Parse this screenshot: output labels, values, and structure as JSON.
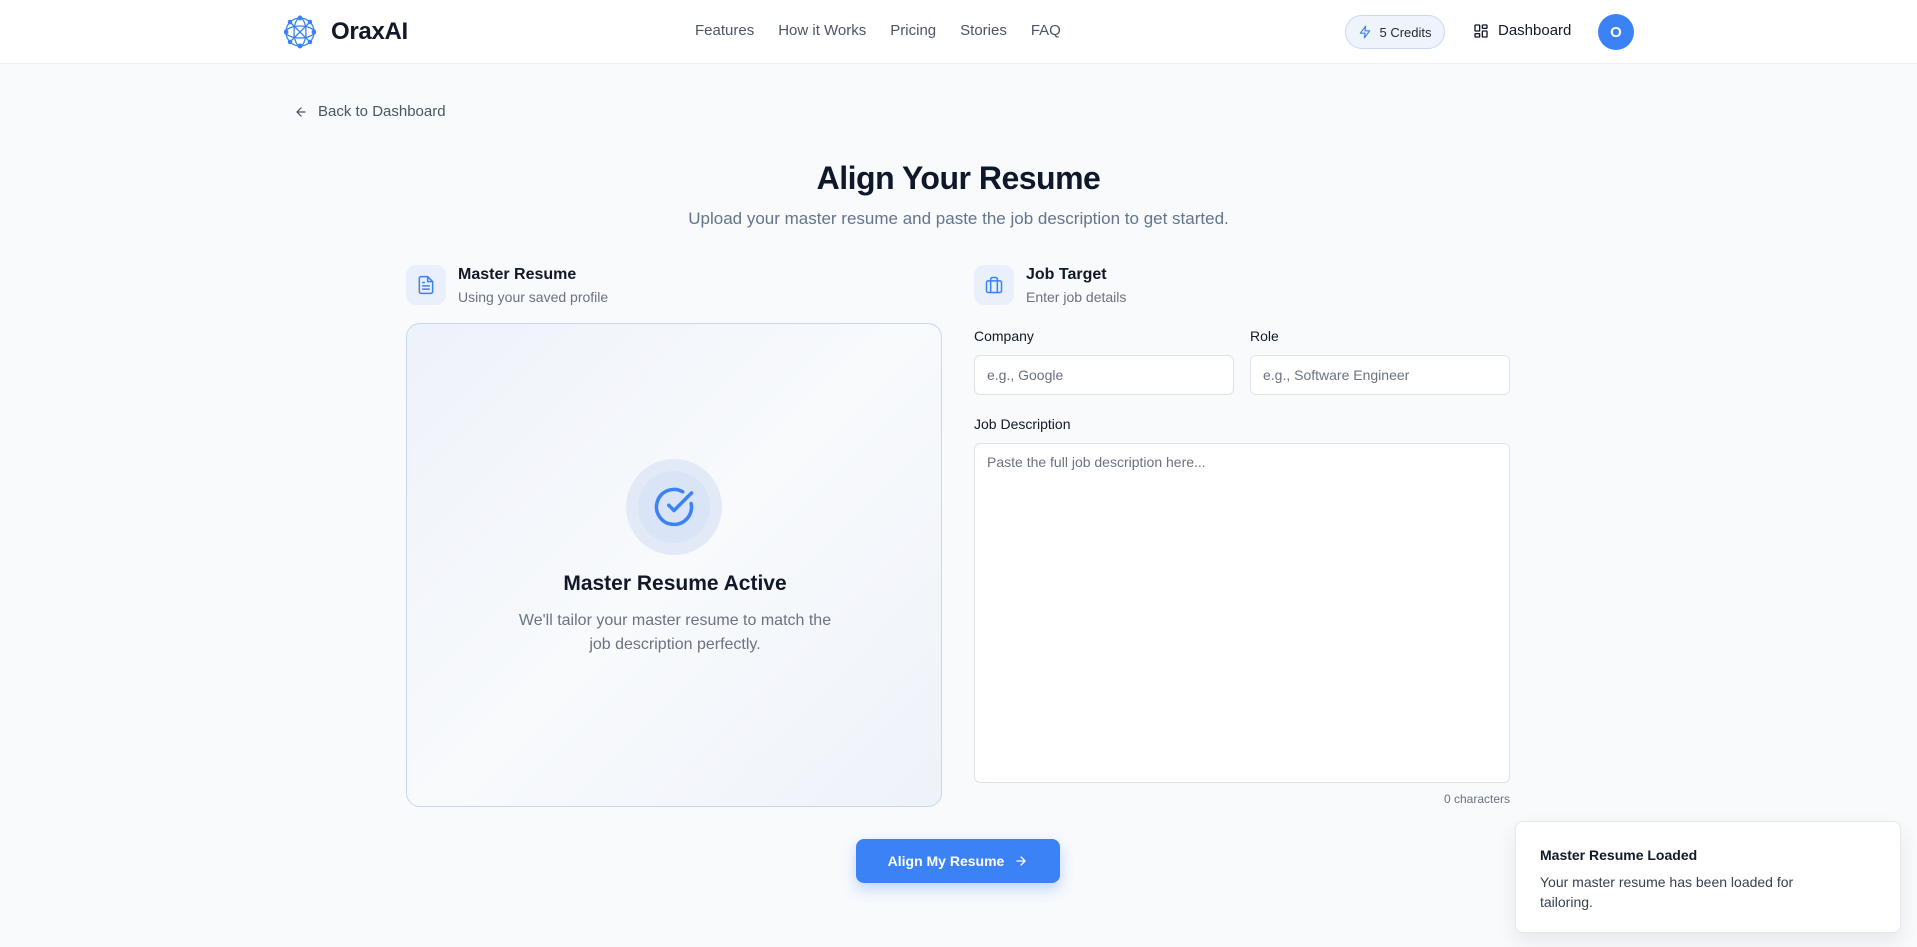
{
  "header": {
    "brand": "OraxAI",
    "logo_icon": "network-sphere-icon",
    "nav": [
      "Features",
      "How it Works",
      "Pricing",
      "Stories",
      "FAQ"
    ],
    "credits_label": "5 Credits",
    "credits_icon": "lightning-icon",
    "dashboard_label": "Dashboard",
    "dashboard_icon": "grid-icon",
    "avatar_initial": "O"
  },
  "back_link": {
    "label": "Back to Dashboard",
    "icon": "arrow-left-icon"
  },
  "page": {
    "title": "Align Your Resume",
    "subtitle": "Upload your master resume and paste the job description to get started."
  },
  "master_resume": {
    "title": "Master Resume",
    "subtitle": "Using your saved profile",
    "icon": "document-icon",
    "card_title": "Master Resume Active",
    "card_description": "We'll tailor your master resume to match the job description perfectly.",
    "card_icon": "check-circle-icon"
  },
  "job_target": {
    "title": "Job Target",
    "subtitle": "Enter job details",
    "icon": "briefcase-icon",
    "company_label": "Company",
    "company_placeholder": "e.g., Google",
    "company_value": "",
    "role_label": "Role",
    "role_placeholder": "e.g., Software Engineer",
    "role_value": "",
    "description_label": "Job Description",
    "description_placeholder": "Paste the full job description here...",
    "description_value": "",
    "char_count": "0 characters"
  },
  "submit": {
    "label": "Align My Resume",
    "icon": "arrow-right-icon"
  },
  "toast": {
    "title": "Master Resume Loaded",
    "description": "Your master resume has been loaded for tailoring."
  },
  "colors": {
    "accent": "#3b82f6",
    "background": "#f8fafc",
    "text": "#0f172a",
    "muted": "#6b7280"
  }
}
